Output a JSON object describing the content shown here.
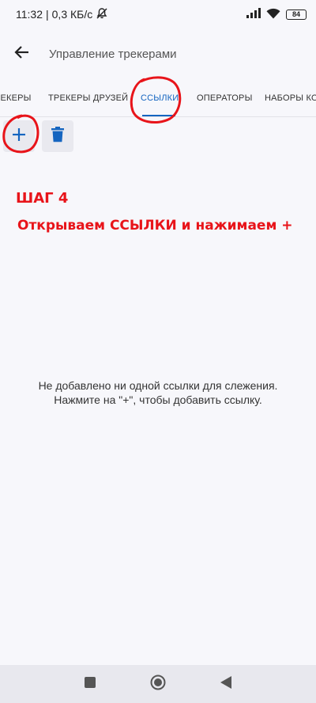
{
  "status_bar": {
    "time": "11:32",
    "separator": "|",
    "network_speed": "0,3 КБ/с",
    "battery_level": "84",
    "icons": [
      "mute-icon",
      "signal-icon",
      "wifi-icon",
      "battery-icon"
    ]
  },
  "app_bar": {
    "title": "Управление трекерами",
    "back_icon": "arrow-left-icon"
  },
  "tabs": [
    {
      "label": "ТРЕКЕРЫ",
      "active": false
    },
    {
      "label": "ТРЕКЕРЫ ДРУЗЕЙ",
      "active": false
    },
    {
      "label": "ССЫЛКИ",
      "active": true
    },
    {
      "label": "ОПЕРАТОРЫ",
      "active": false
    },
    {
      "label": "НАБОРЫ КОМАНД",
      "active": false
    }
  ],
  "toolbar": {
    "add_icon": "plus-icon",
    "delete_icon": "trash-icon"
  },
  "annotation": {
    "step": "ШАГ 4",
    "instruction": "Открываем ССЫЛКИ и нажимаем +"
  },
  "empty_state": {
    "line1": "Не добавлено ни одной ссылки для слежения.",
    "line2": "Нажмите на \"+\", чтобы добавить ссылку."
  },
  "colors": {
    "accent": "#1565c0",
    "annotation": "#e8141a",
    "background": "#f7f7fb"
  }
}
